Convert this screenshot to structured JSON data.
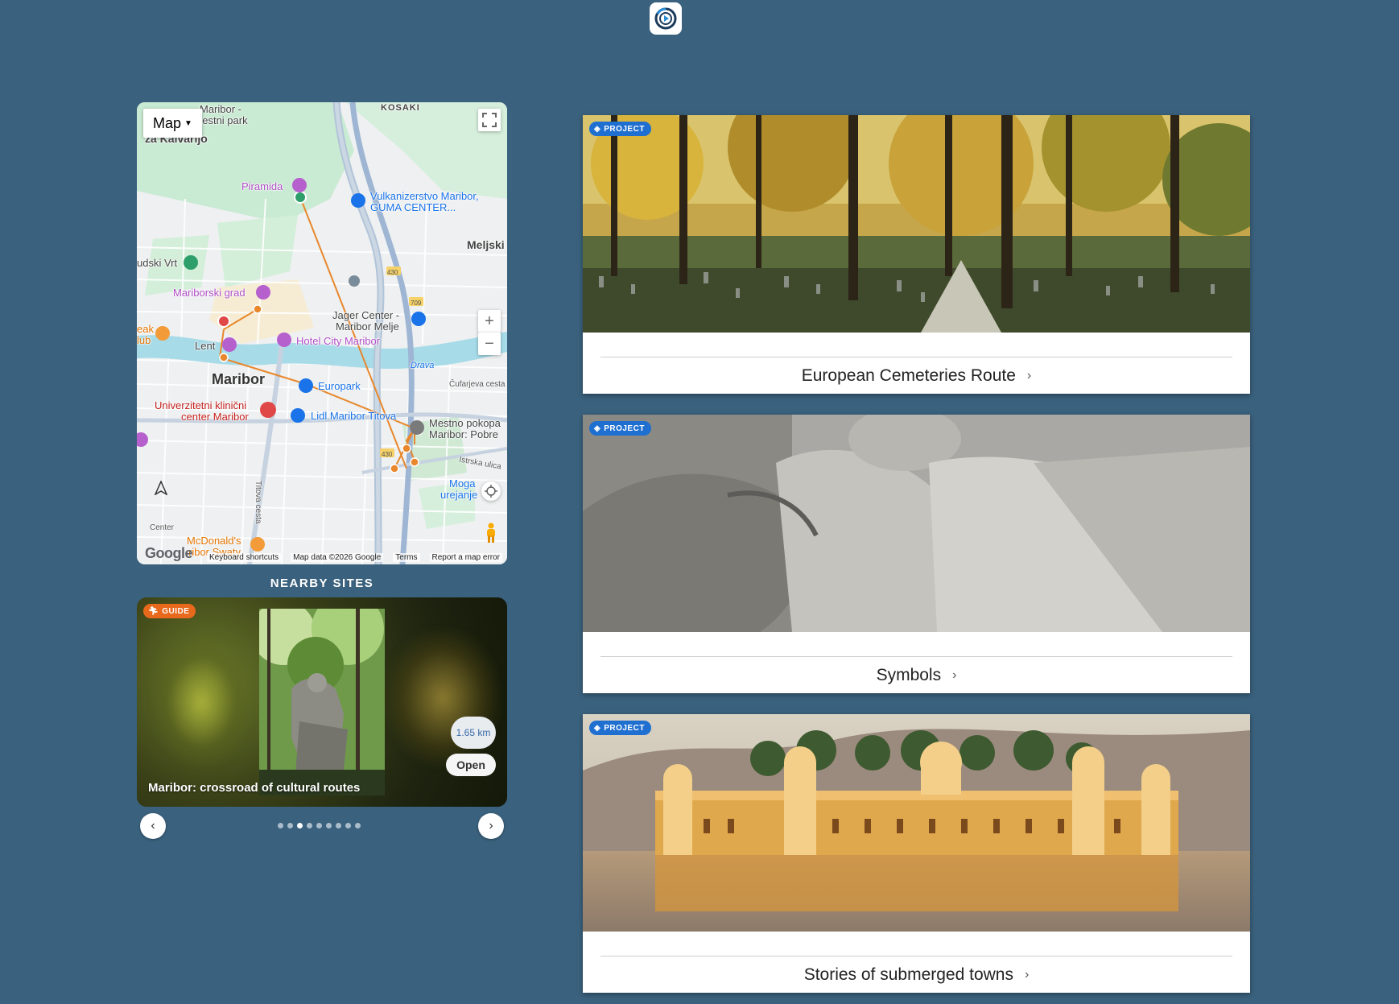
{
  "map": {
    "type_button": "Map",
    "labels": {
      "maribor_park": "Maribor -",
      "mestni_park": "nestni park",
      "za_kalvarijo": "za Kalvarijo",
      "kosaki": "KOSAKI",
      "piramida": "Piramida",
      "vulkanizerstvo_1": "Vulkanizerstvo Maribor,",
      "vulkanizerstvo_2": "GUMA CENTER...",
      "meljski": "Meljski",
      "udski_vrt": "udski Vrt",
      "mariborski_grad": "Mariborski grad",
      "jager_1": "Jager Center -",
      "jager_2": "Maribor Melje",
      "hotel_city": "Hotel City Maribor",
      "eak": "eak",
      "lub": "lub",
      "lent": "Lent",
      "drava": "Drava",
      "maribor": "Maribor",
      "europark": "Europark",
      "cufarjeva": "Čufarjeva cesta",
      "ukc_1": "Univerzitetni klinični",
      "ukc_2": "center Maribor",
      "lidl": "Lidl Maribor Titova",
      "mestno_pokopalisce_1": "Mestno pokopa",
      "mestno_pokopalisce_2": "Maribor: Pobre",
      "istrska": "Istrska ulica",
      "titova_cesta": "Titova cesta",
      "moga_1": "Moga",
      "moga_2": "urejanje",
      "center": "Center",
      "mcdonalds_1": "McDonald's",
      "mcdonalds_2": "ribor Swaty",
      "road_430a": "430",
      "road_709": "709",
      "road_430b": "430"
    },
    "footer": {
      "keyboard": "Keyboard shortcuts",
      "mapdata": "Map data ©2026 Google",
      "terms": "Terms",
      "report": "Report a map error"
    },
    "google": "Google",
    "route_color": "#e8872b"
  },
  "nearby": {
    "title": "NEARBY SITES",
    "card": {
      "badge": "GUIDE",
      "distance": "1.65 km",
      "open_label": "Open",
      "name": "Maribor: crossroad of cultural routes"
    },
    "dots_total": 9,
    "dots_active_index": 2
  },
  "projects": [
    {
      "badge": "PROJECT",
      "title": "European Cemeteries Route"
    },
    {
      "badge": "PROJECT",
      "title": "Symbols"
    },
    {
      "badge": "PROJECT",
      "title": "Stories of submerged towns"
    }
  ],
  "colors": {
    "background": "#3a617d",
    "guide_badge": "#e8691c",
    "project_badge": "#1f6fd1"
  }
}
